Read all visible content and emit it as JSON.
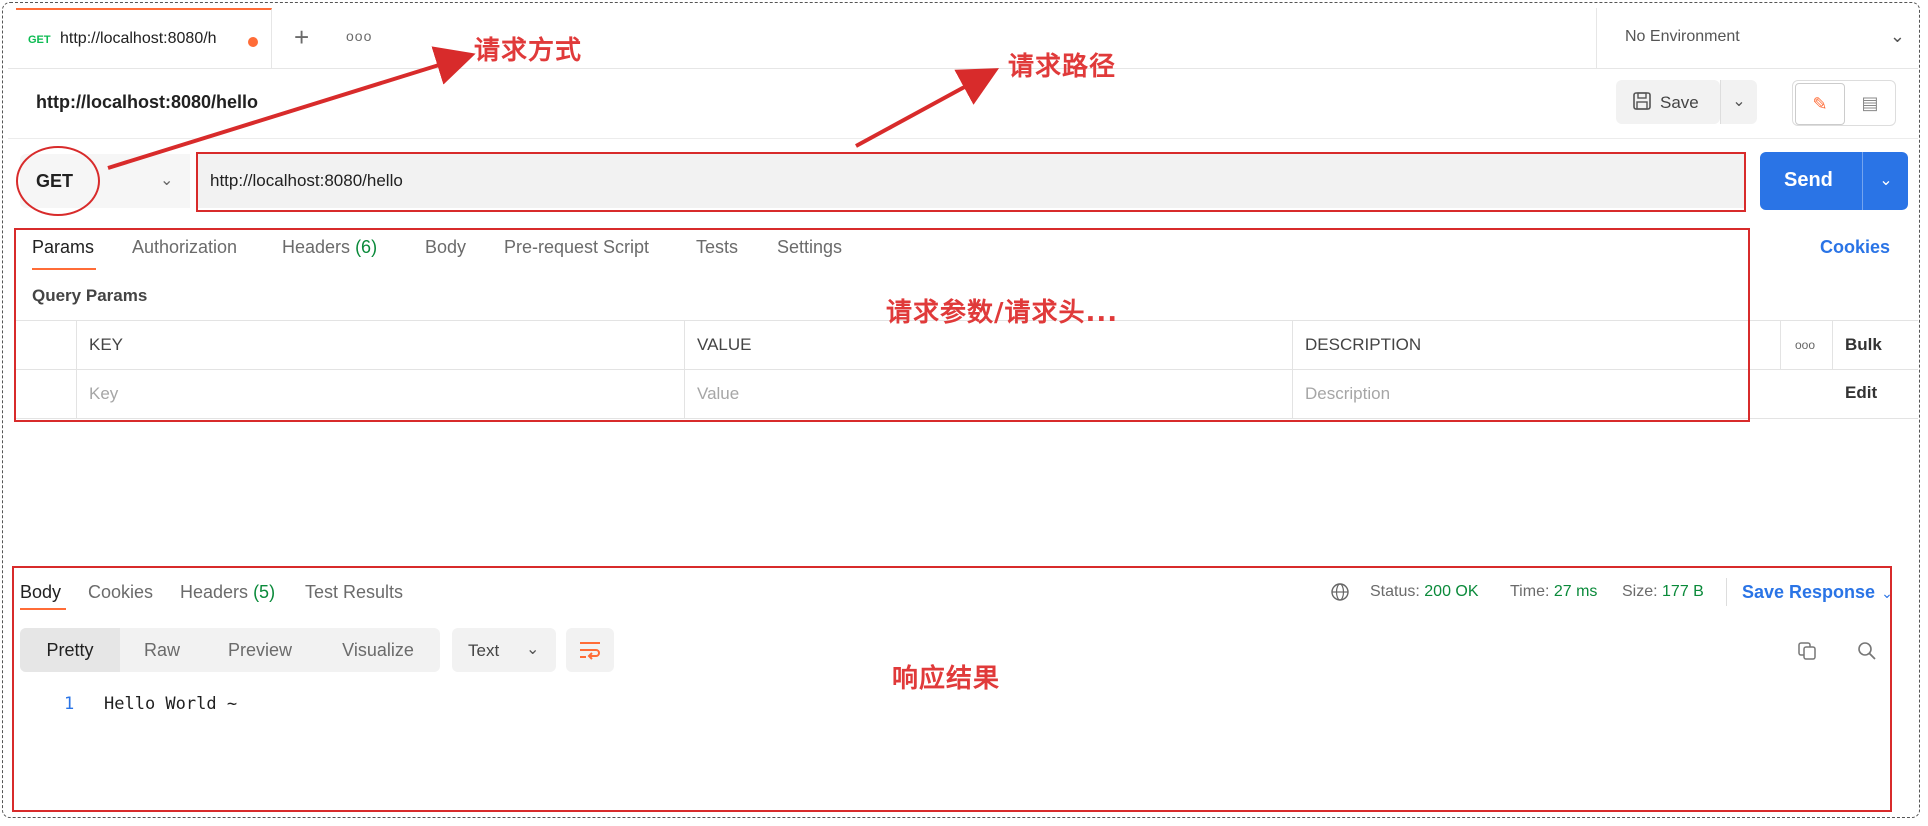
{
  "tab": {
    "method": "GET",
    "title": "http://localhost:8080/h"
  },
  "environment": "No Environment",
  "request": {
    "title": "http://localhost:8080/hello",
    "method": "GET",
    "url": "http://localhost:8080/hello"
  },
  "toolbar": {
    "save_label": "Save",
    "send_label": "Send"
  },
  "request_tabs": [
    "Params",
    "Authorization",
    "Headers",
    "(6)",
    "Body",
    "Pre-request Script",
    "Tests",
    "Settings"
  ],
  "cookies_label": "Cookies",
  "query_params_label": "Query Params",
  "params_table": {
    "headers": [
      "KEY",
      "VALUE",
      "DESCRIPTION"
    ],
    "placeholders": [
      "Key",
      "Value",
      "Description"
    ],
    "more": "ooo",
    "bulk_edit": "Bulk Edit"
  },
  "response": {
    "tabs": [
      "Body",
      "Cookies",
      "Headers",
      "(5)",
      "Test Results"
    ],
    "status_label": "Status:",
    "status_value": "200 OK",
    "time_label": "Time:",
    "time_value": "27 ms",
    "size_label": "Size:",
    "size_value": "177 B",
    "save_response": "Save Response",
    "views": [
      "Pretty",
      "Raw",
      "Preview",
      "Visualize"
    ],
    "format": "Text",
    "line_number": "1",
    "body": "Hello World ~"
  },
  "annotations": {
    "method": "请求方式",
    "path": "请求路径",
    "params": "请求参数/请求头...",
    "result": "响应结果"
  },
  "colors": {
    "accent": "#ff6c37",
    "send": "#2a74e6",
    "annotation": "#d82b2b",
    "ok": "#0a8a3a"
  }
}
